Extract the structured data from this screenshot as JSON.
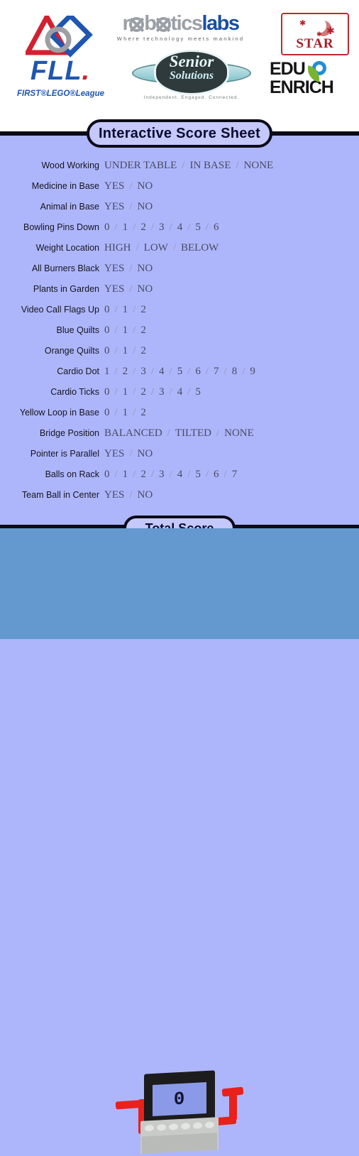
{
  "header": {
    "logos": [
      {
        "name": "fll-logo",
        "text": "FLL",
        "dot": ".",
        "subtitle": "FIRST®LEGO®League"
      },
      {
        "name": "robotics-labs-logo",
        "word_part1": "r",
        "word_part2": "b",
        "word_part3": "tics",
        "word_part4": "labs",
        "tagline": "Where technology meets mankind"
      },
      {
        "name": "senior-solutions-logo",
        "line1": "Senior",
        "line2": "Solutions",
        "tagline": "Independent. Engaged. Connected."
      },
      {
        "name": "star-logo",
        "text": "STAR"
      },
      {
        "name": "edu-enrich-logo",
        "line1": "EDU",
        "line2": "ENRICH"
      }
    ]
  },
  "title_banner": {
    "label": "Interactive Score Sheet"
  },
  "total_banner": {
    "label": "Total Score"
  },
  "score_sheet": {
    "rows": [
      {
        "label": "Wood Working",
        "options": [
          "UNDER TABLE",
          "IN BASE",
          "NONE"
        ]
      },
      {
        "label": "Medicine in Base",
        "options": [
          "YES",
          "NO"
        ]
      },
      {
        "label": "Animal in Base",
        "options": [
          "YES",
          "NO"
        ]
      },
      {
        "label": "Bowling Pins Down",
        "options": [
          "0",
          "1",
          "2",
          "3",
          "4",
          "5",
          "6"
        ]
      },
      {
        "label": "Weight Location",
        "options": [
          "HIGH",
          "LOW",
          "BELOW"
        ]
      },
      {
        "label": "All Burners Black",
        "options": [
          "YES",
          "NO"
        ]
      },
      {
        "label": "Plants in Garden",
        "options": [
          "YES",
          "NO"
        ]
      },
      {
        "label": "Video Call Flags Up",
        "options": [
          "0",
          "1",
          "2"
        ]
      },
      {
        "label": "Blue Quilts",
        "options": [
          "0",
          "1",
          "2"
        ]
      },
      {
        "label": "Orange Quilts",
        "options": [
          "0",
          "1",
          "2"
        ]
      },
      {
        "label": "Cardio Dot",
        "options": [
          "1",
          "2",
          "3",
          "4",
          "5",
          "6",
          "7",
          "8",
          "9"
        ]
      },
      {
        "label": "Cardio Ticks",
        "options": [
          "0",
          "1",
          "2",
          "3",
          "4",
          "5"
        ]
      },
      {
        "label": "Yellow Loop in Base",
        "options": [
          "0",
          "1",
          "2"
        ]
      },
      {
        "label": "Bridge Position",
        "options": [
          "BALANCED",
          "TILTED",
          "NONE"
        ]
      },
      {
        "label": "Pointer is Parallel",
        "options": [
          "YES",
          "NO"
        ]
      },
      {
        "label": "Balls on Rack",
        "options": [
          "0",
          "1",
          "2",
          "3",
          "4",
          "5",
          "6",
          "7"
        ]
      },
      {
        "label": "Team Ball in Center",
        "options": [
          "YES",
          "NO"
        ]
      }
    ],
    "separator": "/"
  },
  "score_display": {
    "value": "0"
  },
  "colors": {
    "body_background": "#aeb6fb",
    "bottom_panel": "#6399cf",
    "banner_fill": "#c4c8fb",
    "banner_border": "#0b0b18",
    "label_text": "#15151f",
    "option_text": "#474a63",
    "separator_text": "#8e93b4",
    "lego_red": "#e8211c",
    "lcd_screen": "#8a9ae8"
  }
}
